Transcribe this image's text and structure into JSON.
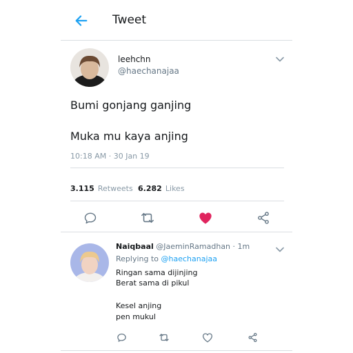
{
  "header": {
    "title": "Tweet",
    "back_icon": "arrow-left-icon",
    "accent": "#1da1f2"
  },
  "tweet": {
    "name": "leehchn",
    "handle": "@haechanajaa",
    "text_line1": "Bumi gonjang ganjing",
    "text_line2": "Muka mu kaya anjing",
    "timestamp": "10:18 AM · 30 Jan 19",
    "retweets_count": "3.115",
    "retweets_label": "Retweets",
    "likes_count": "6.282",
    "likes_label": "Likes",
    "liked": true,
    "like_color": "#e0245e"
  },
  "reply": {
    "name": "Naiqbaal",
    "handle": "@JaeminRamadhan",
    "time": "· 1m",
    "replying_to_label": "Replying to",
    "replying_to_handle": "@haechanajaa",
    "lines": [
      "Ringan sama dijinjing",
      "Berat sama di pikul",
      "",
      "Kesel anjing",
      "pen mukul"
    ]
  }
}
